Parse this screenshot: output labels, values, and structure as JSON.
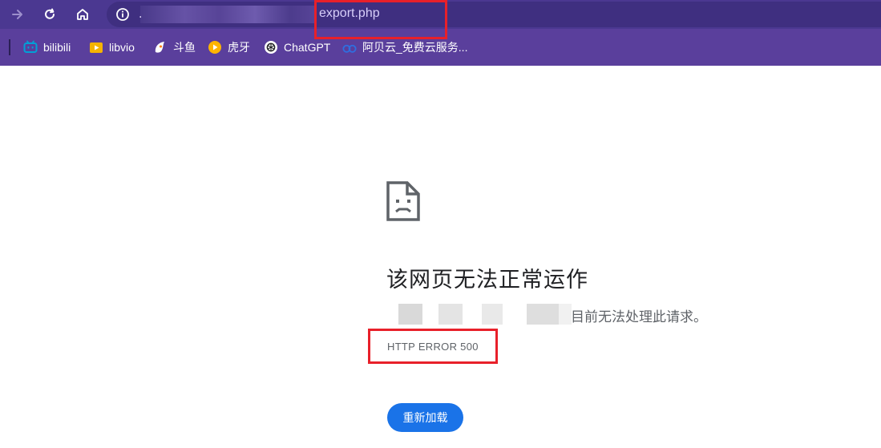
{
  "toolbar": {
    "url_prefix": ".",
    "url_tail": "export.php",
    "icons": [
      "forward-icon",
      "reload-icon",
      "home-icon",
      "site-info-icon"
    ]
  },
  "bookmarks": [
    {
      "label": "bilibili",
      "icon": "bilibili-icon",
      "color": "#00a1d6"
    },
    {
      "label": "libvio",
      "icon": "libvio-icon",
      "color": "#f5b300"
    },
    {
      "label": "斗鱼",
      "icon": "douyu-icon",
      "color": "#ff7a00"
    },
    {
      "label": "虎牙",
      "icon": "huya-icon",
      "color": "#ffb400"
    },
    {
      "label": "ChatGPT",
      "icon": "chatgpt-icon",
      "color": "#ffffff"
    },
    {
      "label": "阿贝云_免费云服务...",
      "icon": "abeiyun-icon",
      "color": "#2f6fe0"
    }
  ],
  "error_page": {
    "icon": "sad-page-icon",
    "title": "该网页无法正常运作",
    "description": "目前无法处理此请求。",
    "code": "HTTP ERROR 500",
    "reload_label": "重新加载"
  },
  "colors": {
    "toolbar_bg": "#4b3891",
    "bookmarks_bg": "#5a3f9c",
    "annotation_red": "#e8202a",
    "button_blue": "#1a73e8"
  }
}
